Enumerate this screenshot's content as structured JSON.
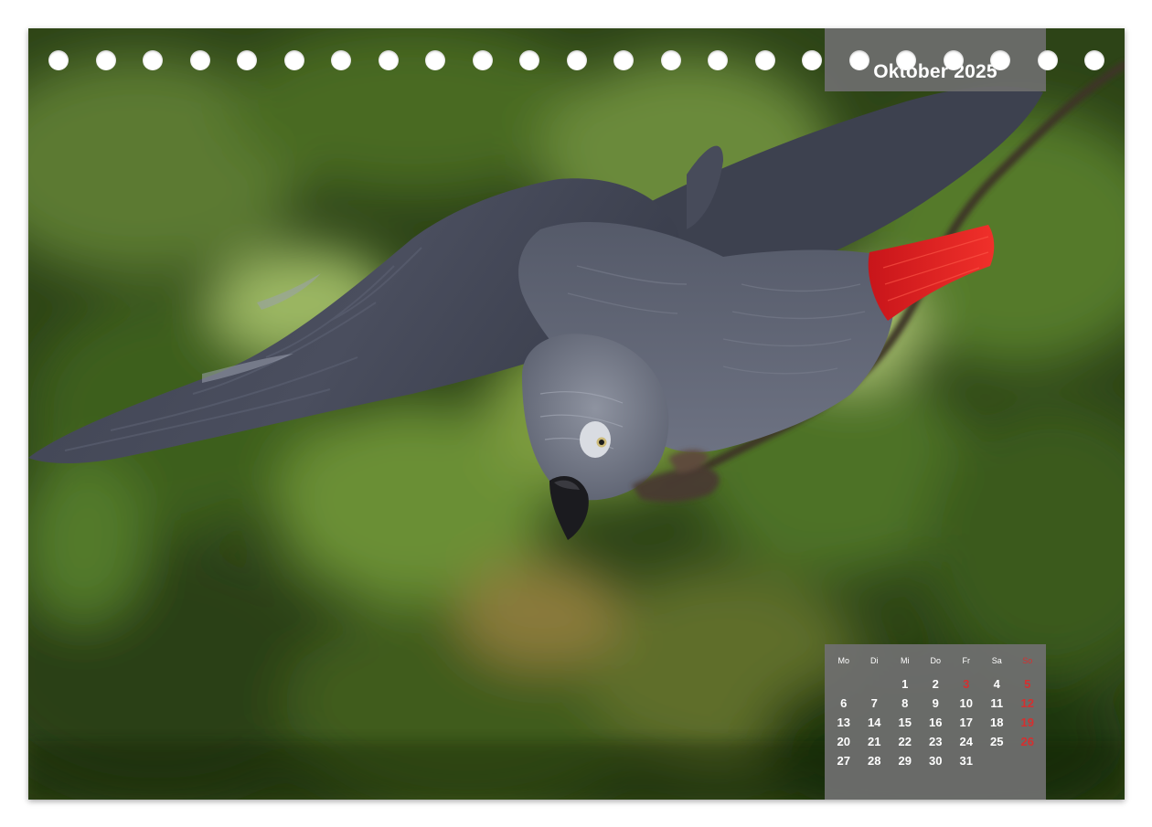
{
  "calendar": {
    "month_title": "Oktober 2025",
    "weekdays": [
      "Mo",
      "Di",
      "Mi",
      "Do",
      "Fr",
      "Sa",
      "So"
    ],
    "weekday_red": [
      false,
      false,
      false,
      false,
      false,
      false,
      true
    ],
    "weeks": [
      [
        {
          "d": ""
        },
        {
          "d": ""
        },
        {
          "d": "1"
        },
        {
          "d": "2"
        },
        {
          "d": "3",
          "red": true
        },
        {
          "d": "4"
        },
        {
          "d": "5",
          "red": true
        }
      ],
      [
        {
          "d": "6"
        },
        {
          "d": "7"
        },
        {
          "d": "8"
        },
        {
          "d": "9"
        },
        {
          "d": "10"
        },
        {
          "d": "11"
        },
        {
          "d": "12",
          "red": true
        }
      ],
      [
        {
          "d": "13"
        },
        {
          "d": "14"
        },
        {
          "d": "15"
        },
        {
          "d": "16"
        },
        {
          "d": "17"
        },
        {
          "d": "18"
        },
        {
          "d": "19",
          "red": true
        }
      ],
      [
        {
          "d": "20"
        },
        {
          "d": "21"
        },
        {
          "d": "22"
        },
        {
          "d": "23"
        },
        {
          "d": "24"
        },
        {
          "d": "25"
        },
        {
          "d": "26",
          "red": true
        }
      ],
      [
        {
          "d": "27"
        },
        {
          "d": "28"
        },
        {
          "d": "29"
        },
        {
          "d": "30"
        },
        {
          "d": "31"
        },
        {
          "d": ""
        },
        {
          "d": ""
        }
      ]
    ]
  },
  "binding": {
    "hole_count": 23
  },
  "photo": {
    "subject": "parrot"
  },
  "colors": {
    "label_background": "#6e6e6e",
    "holiday_red": "#d43030",
    "parrot_grey": "#5b5f6e",
    "tail_red": "#e0201c",
    "foliage_green": "#3c5a22"
  }
}
